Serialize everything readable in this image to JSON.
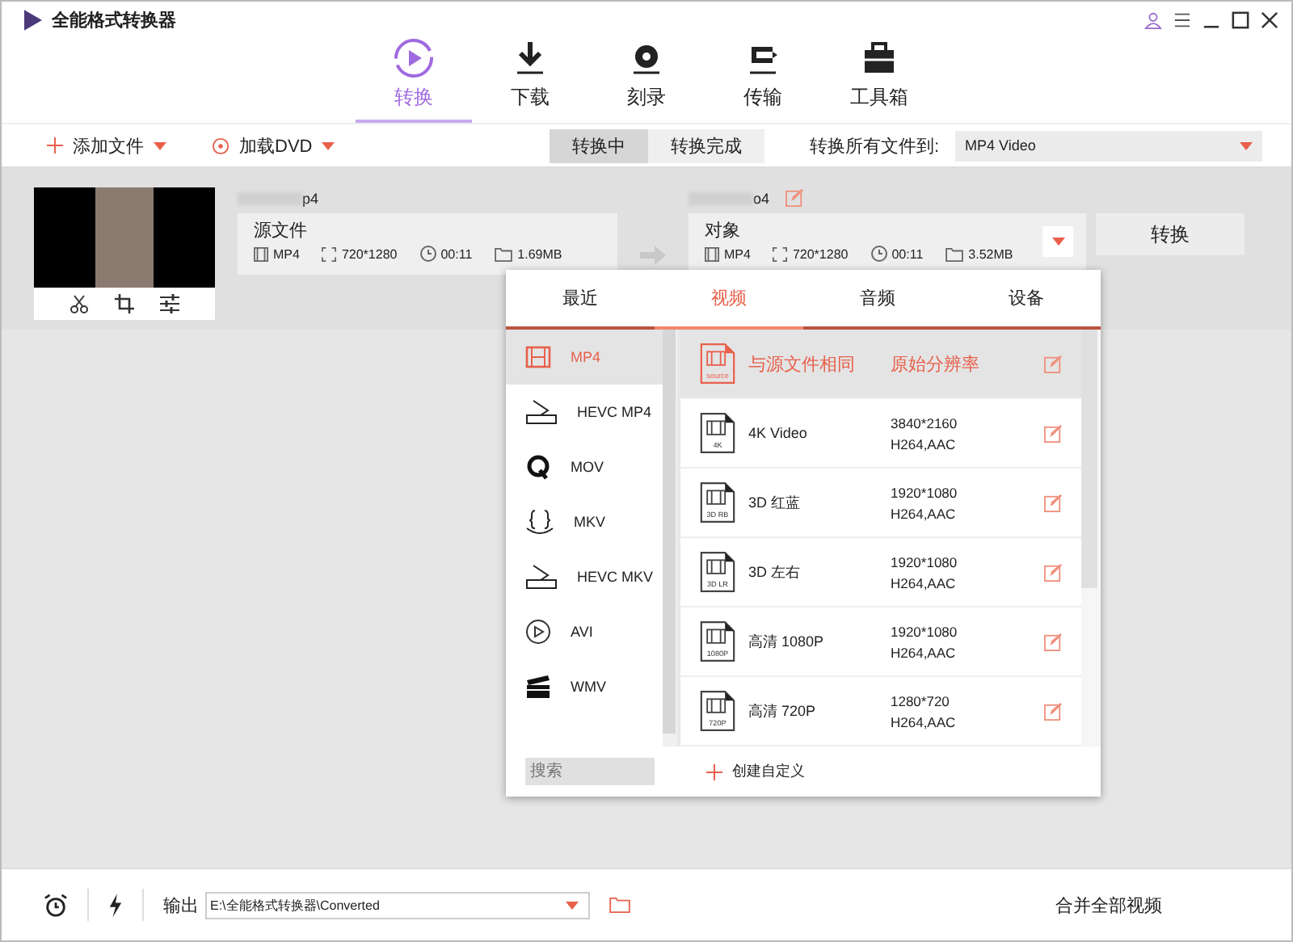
{
  "window": {
    "title": "全能格式转换器"
  },
  "nav_tabs": [
    {
      "label": "转换",
      "kind": "convert",
      "selected": true
    },
    {
      "label": "下载",
      "kind": "download",
      "selected": false
    },
    {
      "label": "刻录",
      "kind": "burn",
      "selected": false
    },
    {
      "label": "传输",
      "kind": "transfer",
      "selected": false
    },
    {
      "label": "工具箱",
      "kind": "toolbox",
      "selected": false
    }
  ],
  "toolbar": {
    "add_file": "添加文件",
    "load_dvd": "加载DVD",
    "segments": [
      {
        "label": "转换中",
        "selected": true
      },
      {
        "label": "转换完成",
        "selected": false
      }
    ],
    "convert_all_label": "转换所有文件到:",
    "convert_all_value": "MP4 Video"
  },
  "file": {
    "source_name": "p4",
    "target_name": "o4",
    "source": {
      "title": "源文件",
      "format": "MP4",
      "resolution": "720*1280",
      "duration": "00:11",
      "size": "1.69MB"
    },
    "target": {
      "title": "对象",
      "format": "MP4",
      "resolution": "720*1280",
      "duration": "00:11",
      "size": "3.52MB"
    },
    "convert_button": "转换"
  },
  "popup": {
    "tabs": [
      {
        "label": "最近",
        "selected": false
      },
      {
        "label": "视频",
        "selected": true
      },
      {
        "label": "音频",
        "selected": false
      },
      {
        "label": "设备",
        "selected": false
      }
    ],
    "formats": [
      {
        "label": "MP4",
        "kind": "film",
        "selected": true
      },
      {
        "label": "HEVC MP4",
        "kind": "hevc",
        "selected": false
      },
      {
        "label": "MOV",
        "kind": "q",
        "selected": false
      },
      {
        "label": "MKV",
        "kind": "braces",
        "selected": false
      },
      {
        "label": "HEVC MKV",
        "kind": "hevc",
        "selected": false
      },
      {
        "label": "AVI",
        "kind": "play",
        "selected": false
      },
      {
        "label": "WMV",
        "kind": "clapper",
        "selected": false
      }
    ],
    "presets": [
      {
        "name": "与源文件相同",
        "badge": "source",
        "spec": "原始分辨率",
        "selected": true
      },
      {
        "name": "4K Video",
        "badge": "4K",
        "spec": "3840*2160",
        "codec": "H264,AAC",
        "selected": false
      },
      {
        "name": "3D 红蓝",
        "badge": "3D RB",
        "spec": "1920*1080",
        "codec": "H264,AAC",
        "selected": false
      },
      {
        "name": "3D 左右",
        "badge": "3D LR",
        "spec": "1920*1080",
        "codec": "H264,AAC",
        "selected": false
      },
      {
        "name": "高清 1080P",
        "badge": "1080P",
        "spec": "1920*1080",
        "codec": "H264,AAC",
        "selected": false
      },
      {
        "name": "高清 720P",
        "badge": "720P",
        "spec": "1280*720",
        "codec": "H264,AAC",
        "selected": false
      }
    ],
    "search_placeholder": "搜索",
    "create_custom": "创建自定义"
  },
  "bottom": {
    "output_label": "输出",
    "output_path": "E:\\全能格式转换器\\Converted",
    "merge_label": "合并全部视频"
  }
}
